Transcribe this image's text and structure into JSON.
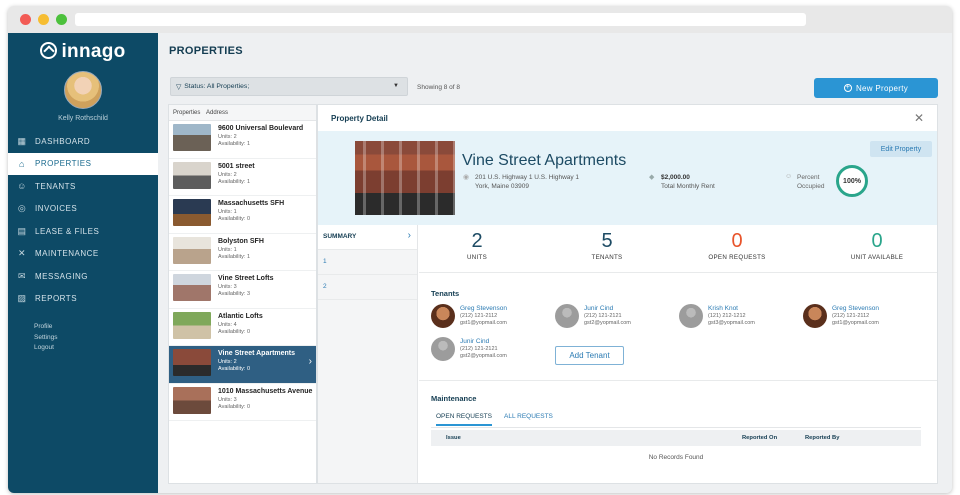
{
  "app": {
    "brand": "innago",
    "user_name": "Kelly Rothschild",
    "nav": [
      {
        "label": "DASHBOARD",
        "icon": "dashboard-icon",
        "glyph": "▦"
      },
      {
        "label": "PROPERTIES",
        "icon": "house-icon",
        "glyph": "⌂"
      },
      {
        "label": "TENANTS",
        "icon": "people-icon",
        "glyph": "☺"
      },
      {
        "label": "INVOICES",
        "icon": "coins-icon",
        "glyph": "◎"
      },
      {
        "label": "LEASE & FILES",
        "icon": "document-icon",
        "glyph": "▤"
      },
      {
        "label": "MAINTENANCE",
        "icon": "tools-icon",
        "glyph": "✕"
      },
      {
        "label": "MESSAGING",
        "icon": "envelope-icon",
        "glyph": "✉"
      },
      {
        "label": "REPORTS",
        "icon": "report-icon",
        "glyph": "▨"
      }
    ],
    "active_nav": 1,
    "sub_links": [
      "Profile",
      "Settings",
      "Logout"
    ]
  },
  "page": {
    "title": "PROPERTIES",
    "filter_label": "Status: All Properties;",
    "showing": "Showing 8 of 8",
    "new_property": "New Property"
  },
  "property_list": {
    "headers": [
      "Properties",
      "Address"
    ],
    "items": [
      {
        "name": "9600 Universal Boulevard",
        "units": "Units: 2",
        "availability": "Availability: 1"
      },
      {
        "name": "5001 street",
        "units": "Units: 2",
        "availability": "Availability: 1"
      },
      {
        "name": "Massachusetts SFH",
        "units": "Units: 1",
        "availability": "Availability: 0"
      },
      {
        "name": "Bolyston SFH",
        "units": "Units: 1",
        "availability": "Availability: 1"
      },
      {
        "name": "Vine Street Lofts",
        "units": "Units: 3",
        "availability": "Availability: 3"
      },
      {
        "name": "Atlantic Lofts",
        "units": "Units: 4",
        "availability": "Availability: 0"
      },
      {
        "name": "Vine Street Apartments",
        "units": "Units: 2",
        "availability": "Availability: 0"
      },
      {
        "name": "1010 Massachusetts Avenue",
        "units": "Units: 3",
        "availability": "Availability: 0"
      }
    ],
    "selected_index": 6
  },
  "detail": {
    "title": "Property Detail",
    "edit_label": "Edit Property",
    "property_name": "Vine Street Apartments",
    "address_line1": "201 U.S. Highway 1 U.S. Highway 1",
    "address_line2": "York, Maine 03909",
    "rent_amount": "$2,000.00",
    "rent_label": "Total Monthly Rent",
    "percent_label_1": "Percent",
    "percent_label_2": "Occupied",
    "percent_value": "100%",
    "side_tabs": [
      "SUMMARY",
      "1",
      "2"
    ],
    "stats": [
      {
        "value": "2",
        "label": "UNITS",
        "color": "#1d4b64"
      },
      {
        "value": "5",
        "label": "TENANTS",
        "color": "#1d4b64"
      },
      {
        "value": "0",
        "label": "OPEN REQUESTS",
        "color": "#e8542b"
      },
      {
        "value": "0",
        "label": "UNIT AVAILABLE",
        "color": "#2aa58b"
      }
    ],
    "tenants_title": "Tenants",
    "tenants": [
      {
        "name": "Greg Stevenson",
        "phone": "(212) 121-2112",
        "email": "gst1@yopmail.com",
        "avatar": "photo"
      },
      {
        "name": "Junir Cind",
        "phone": "(212) 121-2121",
        "email": "gst2@yopmail.com",
        "avatar": "blank"
      },
      {
        "name": "Krish Knot",
        "phone": "(121) 212-1212",
        "email": "gst3@yopmail.com",
        "avatar": "blank"
      },
      {
        "name": "Greg Stevenson",
        "phone": "(212) 121-2112",
        "email": "gst1@yopmail.com",
        "avatar": "photo"
      },
      {
        "name": "Junir Cind",
        "phone": "(212) 121-2121",
        "email": "gst2@yopmail.com",
        "avatar": "blank"
      }
    ],
    "add_tenant": "Add Tenant",
    "maintenance_title": "Maintenance",
    "maintenance_tabs": [
      "OPEN REQUESTS",
      "ALL REQUESTS"
    ],
    "maintenance_columns": [
      "Issue",
      "Reported On",
      "Reported By"
    ],
    "no_records": "No Records Found"
  }
}
